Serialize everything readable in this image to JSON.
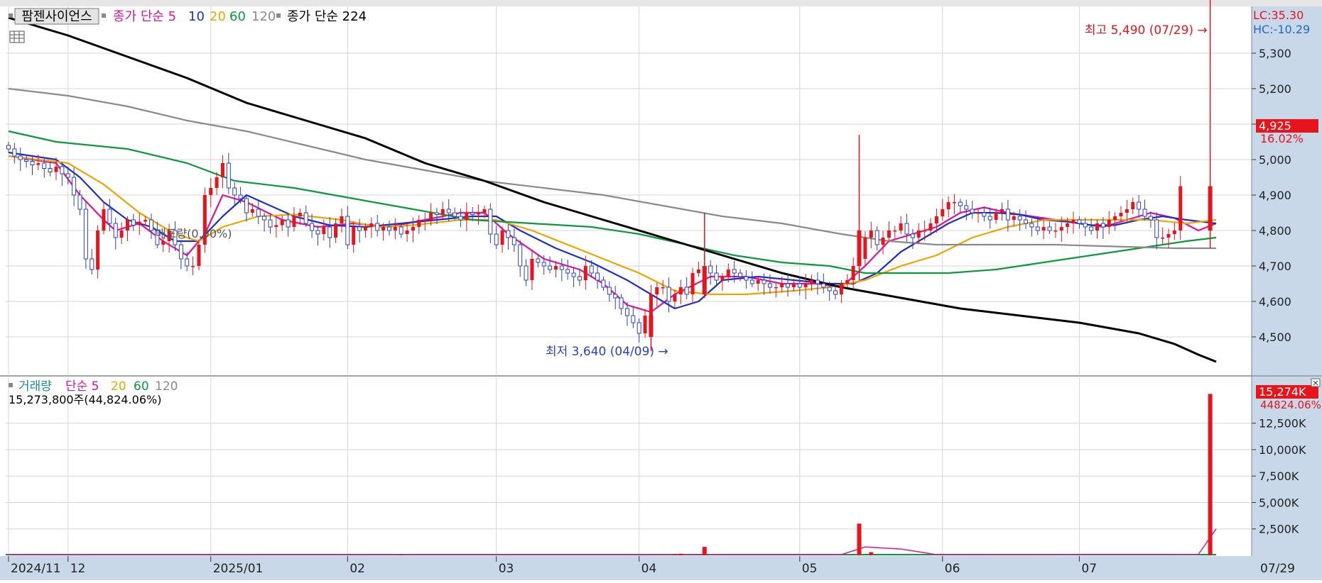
{
  "price_legend": [
    {
      "text": "팜젠사이언스",
      "color": "#000000"
    },
    {
      "text": "종가 단순 5",
      "color": "#e0149b"
    },
    {
      "text": "10",
      "color": "#1f2ec8"
    },
    {
      "text": "20",
      "color": "#f0a400"
    },
    {
      "text": "60",
      "color": "#0b9a3a"
    },
    {
      "text": "120",
      "color": "#8a8a8a"
    },
    {
      "text": "종가 단순 224",
      "color": "#000000"
    }
  ],
  "volume_legend": [
    {
      "text": "거래량",
      "color": "#1a8aa0"
    },
    {
      "text": "단순 5",
      "color": "#e0149b"
    },
    {
      "text": "20",
      "color": "#f0a400"
    },
    {
      "text": "60",
      "color": "#0b9a3a"
    },
    {
      "text": "120",
      "color": "#8a8a8a"
    }
  ],
  "volume_info": "15,273,800주(44,824.06%)",
  "lc_label": "LC:35.30",
  "hc_label": "HC:-10.29",
  "high_annotation": "최고 5,490 (07/29) →",
  "low_annotation": "최저 3,640 (04/09) →",
  "overlap_text": "매도량(0.00%)",
  "current_price": "4,925",
  "current_change": "16.02%",
  "current_volume": "15,274K",
  "current_volume_pct": "44824.06%",
  "colors": {
    "up": "#e8141c",
    "down": "#2b3fc8",
    "panel": "#c8d8e8"
  },
  "chart_data": {
    "type": "line",
    "series_name": "팜젠사이언스",
    "price_axis": {
      "ylim": [
        4410,
        5400
      ],
      "ticks": [
        4500,
        4600,
        4700,
        4800,
        4900,
        5000,
        5100,
        5200,
        5300
      ],
      "tick_labels": [
        "4,500",
        "4,600",
        "4,700",
        "4,800",
        "4,900",
        "5,000",
        "5,100",
        "5,200",
        "5,300"
      ]
    },
    "volume_axis": {
      "ylim": [
        0,
        15500
      ],
      "ticks": [
        2500,
        5000,
        7500,
        10000,
        12500
      ],
      "tick_labels": [
        "2,500K",
        "5,000K",
        "7,500K",
        "10,000K",
        "12,500K"
      ]
    },
    "x_labels": [
      {
        "label": "2024/11",
        "index": 0
      },
      {
        "label": "12",
        "index": 10
      },
      {
        "label": "2025/01",
        "index": 34
      },
      {
        "label": "02",
        "index": 57
      },
      {
        "label": "03",
        "index": 82
      },
      {
        "label": "04",
        "index": 106
      },
      {
        "label": "05",
        "index": 133
      },
      {
        "label": "06",
        "index": 157
      },
      {
        "label": "07",
        "index": 180
      }
    ],
    "x_end_label": "07/29",
    "closes": [
      5030,
      5010,
      5000,
      4995,
      4985,
      4990,
      4975,
      4965,
      4980,
      4960,
      4950,
      4900,
      4860,
      4720,
      4690,
      4800,
      4860,
      4820,
      4780,
      4800,
      4830,
      4815,
      4825,
      4830,
      4800,
      4760,
      4770,
      4800,
      4760,
      4720,
      4700,
      4700,
      4760,
      4900,
      4920,
      4950,
      4990,
      4920,
      4900,
      4890,
      4850,
      4860,
      4840,
      4830,
      4810,
      4815,
      4830,
      4810,
      4840,
      4850,
      4820,
      4800,
      4790,
      4810,
      4780,
      4820,
      4840,
      4760,
      4810,
      4800,
      4810,
      4820,
      4800,
      4810,
      4800,
      4810,
      4790,
      4800,
      4810,
      4830,
      4830,
      4850,
      4845,
      4860,
      4850,
      4840,
      4830,
      4850,
      4845,
      4850,
      4860,
      4790,
      4760,
      4800,
      4780,
      4760,
      4700,
      4660,
      4720,
      4710,
      4700,
      4690,
      4700,
      4690,
      4680,
      4670,
      4660,
      4700,
      4680,
      4660,
      4640,
      4620,
      4610,
      4580,
      4560,
      4540,
      4510,
      4560,
      4620,
      4640,
      4640,
      4600,
      4620,
      4640,
      4620,
      4680,
      4690,
      4700,
      4680,
      4660,
      4670,
      4690,
      4680,
      4670,
      4660,
      4650,
      4660,
      4650,
      4640,
      4640,
      4650,
      4640,
      4650,
      4640,
      4650,
      4660,
      4650,
      4640,
      4630,
      4620,
      4650,
      4660,
      4700,
      4720,
      4780,
      4800,
      4760,
      4780,
      4800,
      4800,
      4820,
      4790,
      4780,
      4800,
      4800,
      4820,
      4840,
      4860,
      4880,
      4880,
      4870,
      4860,
      4850,
      4850,
      4840,
      4830,
      4850,
      4860,
      4830,
      4840,
      4830,
      4820,
      4810,
      4800,
      4810,
      4800,
      4800,
      4810,
      4820,
      4830,
      4820,
      4810,
      4800,
      4820,
      4810,
      4830,
      4840,
      4850,
      4860,
      4880,
      4860,
      4840,
      4830,
      4780,
      4780,
      4790,
      4800,
      4925
    ],
    "ma_lines": [
      {
        "name": "종가 단순 5",
        "color": "#e0149b",
        "values": [
          [
            0,
            5010
          ],
          [
            8,
            4990
          ],
          [
            12,
            4900
          ],
          [
            16,
            4830
          ],
          [
            18,
            4800
          ],
          [
            22,
            4820
          ],
          [
            26,
            4770
          ],
          [
            30,
            4730
          ],
          [
            33,
            4790
          ],
          [
            36,
            4900
          ],
          [
            40,
            4880
          ],
          [
            46,
            4830
          ],
          [
            52,
            4810
          ],
          [
            58,
            4820
          ],
          [
            64,
            4810
          ],
          [
            70,
            4830
          ],
          [
            76,
            4850
          ],
          [
            80,
            4850
          ],
          [
            84,
            4790
          ],
          [
            90,
            4720
          ],
          [
            96,
            4690
          ],
          [
            100,
            4650
          ],
          [
            104,
            4590
          ],
          [
            108,
            4570
          ],
          [
            112,
            4620
          ],
          [
            118,
            4670
          ],
          [
            124,
            4670
          ],
          [
            130,
            4650
          ],
          [
            136,
            4650
          ],
          [
            140,
            4640
          ],
          [
            144,
            4700
          ],
          [
            148,
            4770
          ],
          [
            152,
            4790
          ],
          [
            156,
            4810
          ],
          [
            160,
            4850
          ],
          [
            164,
            4865
          ],
          [
            168,
            4850
          ],
          [
            172,
            4840
          ],
          [
            176,
            4830
          ],
          [
            180,
            4820
          ],
          [
            184,
            4810
          ],
          [
            188,
            4830
          ],
          [
            192,
            4850
          ],
          [
            196,
            4835
          ],
          [
            200,
            4800
          ],
          [
            203,
            4820
          ]
        ]
      },
      {
        "name": "10",
        "color": "#1f2ec8",
        "values": [
          [
            0,
            5020
          ],
          [
            8,
            5000
          ],
          [
            12,
            4950
          ],
          [
            16,
            4880
          ],
          [
            20,
            4830
          ],
          [
            24,
            4810
          ],
          [
            28,
            4770
          ],
          [
            32,
            4770
          ],
          [
            36,
            4840
          ],
          [
            40,
            4900
          ],
          [
            44,
            4870
          ],
          [
            48,
            4840
          ],
          [
            54,
            4815
          ],
          [
            60,
            4810
          ],
          [
            66,
            4820
          ],
          [
            72,
            4830
          ],
          [
            78,
            4840
          ],
          [
            82,
            4840
          ],
          [
            86,
            4800
          ],
          [
            92,
            4750
          ],
          [
            98,
            4710
          ],
          [
            104,
            4660
          ],
          [
            108,
            4620
          ],
          [
            112,
            4580
          ],
          [
            116,
            4600
          ],
          [
            120,
            4660
          ],
          [
            126,
            4670
          ],
          [
            132,
            4660
          ],
          [
            138,
            4650
          ],
          [
            142,
            4650
          ],
          [
            146,
            4680
          ],
          [
            150,
            4740
          ],
          [
            154,
            4780
          ],
          [
            158,
            4820
          ],
          [
            162,
            4850
          ],
          [
            166,
            4850
          ],
          [
            170,
            4845
          ],
          [
            174,
            4830
          ],
          [
            178,
            4825
          ],
          [
            182,
            4815
          ],
          [
            186,
            4815
          ],
          [
            190,
            4830
          ],
          [
            194,
            4840
          ],
          [
            198,
            4830
          ],
          [
            203,
            4820
          ]
        ]
      },
      {
        "name": "20",
        "color": "#f0a400",
        "values": [
          [
            0,
            5010
          ],
          [
            10,
            4990
          ],
          [
            16,
            4930
          ],
          [
            22,
            4850
          ],
          [
            28,
            4790
          ],
          [
            32,
            4770
          ],
          [
            36,
            4810
          ],
          [
            42,
            4840
          ],
          [
            48,
            4845
          ],
          [
            56,
            4830
          ],
          [
            62,
            4810
          ],
          [
            68,
            4815
          ],
          [
            76,
            4830
          ],
          [
            82,
            4830
          ],
          [
            88,
            4800
          ],
          [
            94,
            4760
          ],
          [
            100,
            4720
          ],
          [
            106,
            4680
          ],
          [
            112,
            4630
          ],
          [
            118,
            4620
          ],
          [
            124,
            4620
          ],
          [
            132,
            4630
          ],
          [
            138,
            4640
          ],
          [
            144,
            4660
          ],
          [
            150,
            4700
          ],
          [
            156,
            4730
          ],
          [
            162,
            4780
          ],
          [
            168,
            4810
          ],
          [
            174,
            4830
          ],
          [
            180,
            4830
          ],
          [
            186,
            4830
          ],
          [
            192,
            4830
          ],
          [
            198,
            4820
          ],
          [
            203,
            4830
          ]
        ]
      },
      {
        "name": "60",
        "color": "#0b9a3a",
        "values": [
          [
            0,
            5080
          ],
          [
            8,
            5050
          ],
          [
            20,
            5030
          ],
          [
            30,
            4990
          ],
          [
            38,
            4940
          ],
          [
            48,
            4920
          ],
          [
            58,
            4890
          ],
          [
            68,
            4860
          ],
          [
            78,
            4830
          ],
          [
            88,
            4820
          ],
          [
            98,
            4810
          ],
          [
            106,
            4790
          ],
          [
            114,
            4760
          ],
          [
            122,
            4730
          ],
          [
            130,
            4710
          ],
          [
            138,
            4700
          ],
          [
            144,
            4680
          ],
          [
            150,
            4680
          ],
          [
            158,
            4680
          ],
          [
            166,
            4690
          ],
          [
            174,
            4710
          ],
          [
            182,
            4730
          ],
          [
            190,
            4750
          ],
          [
            198,
            4770
          ],
          [
            203,
            4780
          ]
        ]
      },
      {
        "name": "120",
        "color": "#8a8a8a",
        "values": [
          [
            0,
            5200
          ],
          [
            10,
            5180
          ],
          [
            20,
            5150
          ],
          [
            30,
            5110
          ],
          [
            40,
            5080
          ],
          [
            50,
            5040
          ],
          [
            60,
            5000
          ],
          [
            70,
            4970
          ],
          [
            80,
            4940
          ],
          [
            90,
            4920
          ],
          [
            100,
            4900
          ],
          [
            110,
            4870
          ],
          [
            120,
            4840
          ],
          [
            130,
            4820
          ],
          [
            140,
            4790
          ],
          [
            148,
            4770
          ],
          [
            156,
            4760
          ],
          [
            166,
            4760
          ],
          [
            176,
            4760
          ],
          [
            186,
            4755
          ],
          [
            196,
            4750
          ],
          [
            203,
            4750
          ]
        ]
      },
      {
        "name": "종가 단순 224",
        "color": "#000000",
        "values": [
          [
            0,
            5400
          ],
          [
            10,
            5350
          ],
          [
            20,
            5290
          ],
          [
            30,
            5230
          ],
          [
            40,
            5160
          ],
          [
            50,
            5110
          ],
          [
            60,
            5060
          ],
          [
            70,
            4990
          ],
          [
            80,
            4940
          ],
          [
            90,
            4880
          ],
          [
            100,
            4830
          ],
          [
            110,
            4780
          ],
          [
            120,
            4730
          ],
          [
            130,
            4680
          ],
          [
            140,
            4640
          ],
          [
            150,
            4610
          ],
          [
            160,
            4580
          ],
          [
            170,
            4560
          ],
          [
            180,
            4540
          ],
          [
            190,
            4510
          ],
          [
            196,
            4480
          ],
          [
            200,
            4450
          ],
          [
            203,
            4430
          ]
        ]
      }
    ],
    "extra_candles": [
      {
        "index": 202,
        "open": 4800,
        "high": 5490,
        "low": 4750,
        "close": 4925
      },
      {
        "index": 143,
        "open": 4700,
        "high": 5070,
        "low": 4660,
        "close": 4800
      },
      {
        "index": 117,
        "open": 4620,
        "high": 4850,
        "low": 4610,
        "close": 4700
      },
      {
        "index": 108,
        "open": 4500,
        "high": 4560,
        "low": 4460,
        "close": 4560
      }
    ],
    "volumes": [
      [
        202,
        15274
      ],
      [
        143,
        3000
      ],
      [
        117,
        800
      ],
      [
        66,
        80
      ],
      [
        112,
        120
      ],
      [
        113,
        150
      ],
      [
        145,
        300
      ]
    ],
    "volume_ma": [
      [
        0,
        60
      ],
      [
        60,
        60
      ],
      [
        100,
        60
      ],
      [
        140,
        70
      ],
      [
        144,
        800
      ],
      [
        150,
        600
      ],
      [
        156,
        70
      ],
      [
        200,
        80
      ],
      [
        203,
        2500
      ]
    ]
  }
}
